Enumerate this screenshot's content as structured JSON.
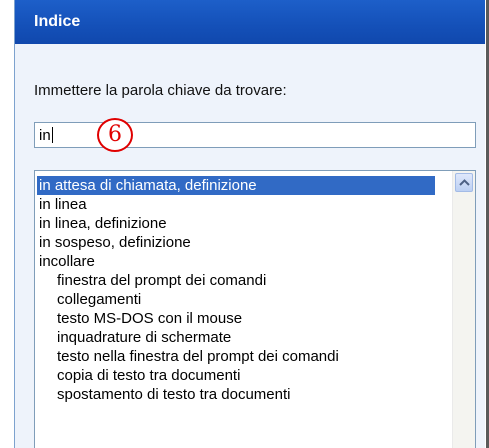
{
  "pane": {
    "title": "Indice"
  },
  "search": {
    "prompt": "Immettere la parola chiave da trovare:",
    "value": "in"
  },
  "annotation": {
    "step": "6",
    "color": "#e00000"
  },
  "list": {
    "items": [
      {
        "label": "in attesa di chiamata, definizione",
        "selected": true
      },
      {
        "label": "in linea"
      },
      {
        "label": "in linea, definizione"
      },
      {
        "label": "in sospeso, definizione"
      },
      {
        "label": "incollare"
      },
      {
        "label": "finestra del prompt dei comandi",
        "indent": true
      },
      {
        "label": "collegamenti",
        "indent": true
      },
      {
        "label": "testo MS-DOS con il mouse",
        "indent": true
      },
      {
        "label": "inquadrature di schermate",
        "indent": true
      },
      {
        "label": "testo nella finestra del prompt dei comandi",
        "indent": true
      },
      {
        "label": "copia di testo tra documenti",
        "indent": true
      },
      {
        "label": "spostamento di testo tra documenti",
        "indent": true
      }
    ]
  },
  "colors": {
    "header": "#1450b8",
    "selection": "#316ac5",
    "pane_bg": "#eef3fb"
  },
  "icons": {
    "scroll_up": "chevron-up-icon"
  }
}
